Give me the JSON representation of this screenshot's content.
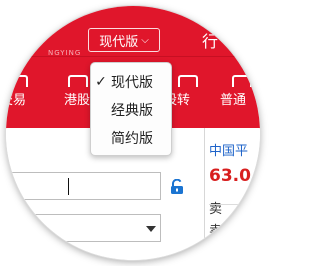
{
  "header": {
    "logo_subtext": "NGYING",
    "version_button": {
      "label": "现代版",
      "chevron": "⌵"
    },
    "right_text": "行"
  },
  "nav": {
    "items": [
      {
        "label": "交易",
        "icon": "trade-icon"
      },
      {
        "label": "港股",
        "icon": "hk-stock-icon"
      },
      {
        "label": "股转",
        "icon": "transfer-icon"
      },
      {
        "label": "普通",
        "icon": "normal-icon"
      }
    ]
  },
  "dropdown": {
    "items": [
      {
        "label": "现代版",
        "checked": true
      },
      {
        "label": "经典版",
        "checked": false
      },
      {
        "label": "简约版",
        "checked": false
      }
    ],
    "check_glyph": "✓"
  },
  "form": {
    "password_value": "",
    "lock_icon": "unlock-icon",
    "select_value": ""
  },
  "quote": {
    "stock_name": "中国平",
    "price": "63.0",
    "sell_label": "卖",
    "sell_label2": "卖"
  },
  "colors": {
    "brand_red": "#e0162b",
    "price_red": "#d81e1e",
    "link_blue": "#1e63c9"
  }
}
